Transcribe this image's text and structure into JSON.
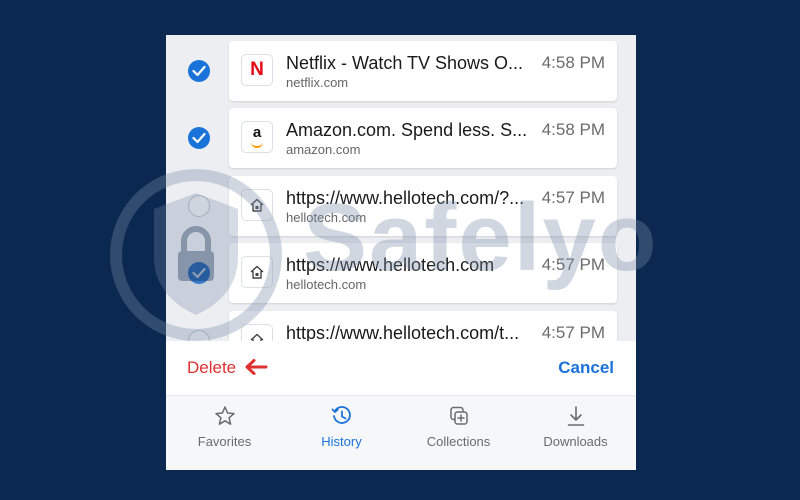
{
  "watermark": {
    "text": "Safelyo"
  },
  "history": [
    {
      "title": "Netflix - Watch TV Shows O...",
      "domain": "netflix.com",
      "time": "4:58 PM",
      "checked": true,
      "icon": "netflix-icon"
    },
    {
      "title": "Amazon.com. Spend less. S...",
      "domain": "amazon.com",
      "time": "4:58 PM",
      "checked": true,
      "icon": "amazon-icon"
    },
    {
      "title": "https://www.hellotech.com/?...",
      "domain": "hellotech.com",
      "time": "4:57 PM",
      "checked": false,
      "icon": "house-icon"
    },
    {
      "title": "https://www.hellotech.com",
      "domain": "hellotech.com",
      "time": "4:57 PM",
      "checked": true,
      "icon": "house-icon"
    },
    {
      "title": "https://www.hellotech.com/t...",
      "domain": "",
      "time": "4:57 PM",
      "checked": false,
      "icon": "house-icon"
    }
  ],
  "favicon_letters": {
    "netflix": "N",
    "amazon": "a"
  },
  "actions": {
    "delete_label": "Delete",
    "cancel_label": "Cancel"
  },
  "tabs": [
    {
      "label": "Favorites",
      "icon": "star-icon",
      "active": false
    },
    {
      "label": "History",
      "icon": "history-icon",
      "active": true
    },
    {
      "label": "Collections",
      "icon": "collections-icon",
      "active": false
    },
    {
      "label": "Downloads",
      "icon": "download-icon",
      "active": false
    }
  ],
  "colors": {
    "accent": "#1a73d9",
    "delete": "#e03131",
    "background": "#0b2850"
  }
}
